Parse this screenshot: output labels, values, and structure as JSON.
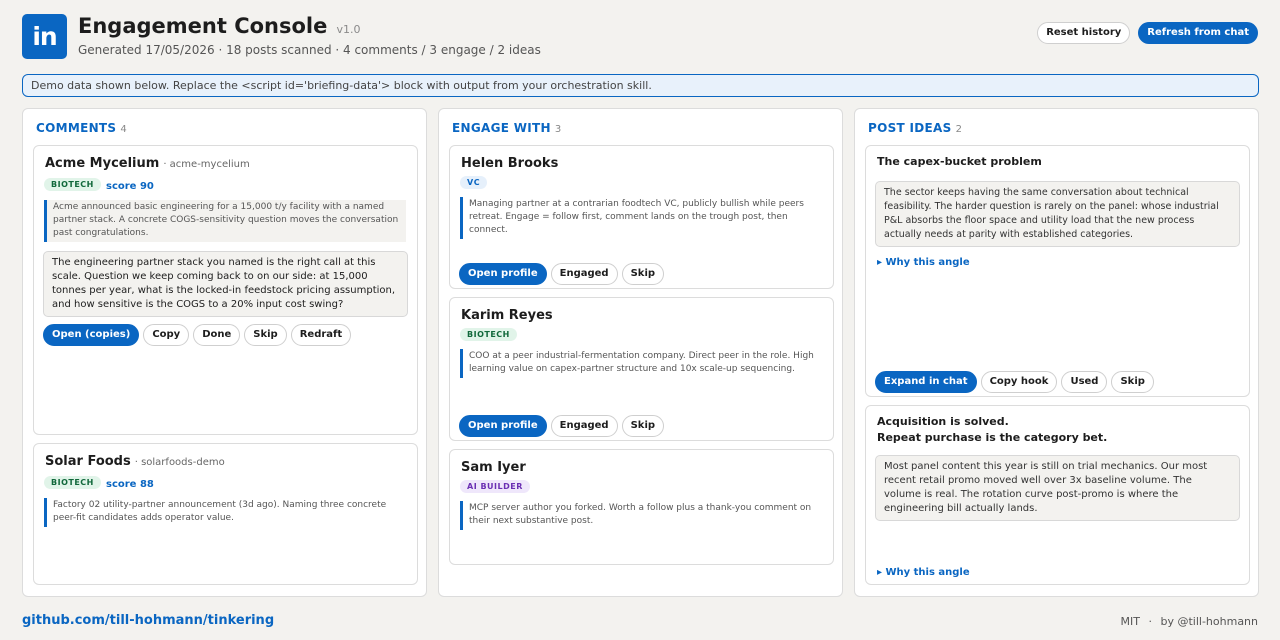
{
  "app": {
    "logo_text": "in",
    "title": "Engagement Console",
    "version": "v1.0",
    "subtitle": "Generated 17/05/2026 · 18 posts scanned · 4 comments / 3 engage / 2 ideas",
    "brand_color": "#0a66c2"
  },
  "header_actions": {
    "reset_label": "Reset history",
    "refresh_label": "Refresh from chat"
  },
  "banner": {
    "text": "Demo data shown below. Replace the <script id='briefing-data'> block with output from your orchestration skill."
  },
  "comments": {
    "heading": "COMMENTS",
    "count": "4",
    "cards": [
      {
        "name": "Acme Mycelium",
        "handle": "· acme-mycelium",
        "tag": "BIOTECH",
        "score": "score 90",
        "context": "Acme announced basic engineering for a 15,000 t/y facility with a named partner stack. A concrete COGS-sensitivity question moves the conversation past congratulations.",
        "draft": "The engineering partner stack you named is the right call at this scale. Question we keep coming back to on our side: at 15,000 tonnes per year, what is the locked-in feedstock pricing assumption, and how sensitive is the COGS to a 20% input cost swing?",
        "actions": [
          "Open (copies)",
          "Copy",
          "Done",
          "Skip",
          "Redraft"
        ]
      },
      {
        "name": "Solar Foods",
        "handle": "· solarfoods-demo",
        "tag": "BIOTECH",
        "score": "score 88",
        "context": "Factory 02 utility-partner announcement (3d ago). Naming three concrete peer-fit candidates adds operator value."
      }
    ]
  },
  "engage": {
    "heading": "ENGAGE WITH",
    "count": "3",
    "cards": [
      {
        "name": "Helen Brooks",
        "tag": "VC",
        "context": "Managing partner at a contrarian foodtech VC, publicly bullish while peers retreat. Engage = follow first, comment lands on the trough post, then connect.",
        "actions": [
          "Open profile",
          "Engaged",
          "Skip"
        ]
      },
      {
        "name": "Karim Reyes",
        "tag": "BIOTECH",
        "context": "COO at a peer industrial-fermentation company. Direct peer in the role. High learning value on capex-partner structure and 10x scale-up sequencing.",
        "actions": [
          "Open profile",
          "Engaged",
          "Skip"
        ]
      },
      {
        "name": "Sam Iyer",
        "tag": "AI BUILDER",
        "context": "MCP server author you forked. Worth a follow plus a thank-you comment on their next substantive post."
      }
    ]
  },
  "ideas": {
    "heading": "POST IDEAS",
    "count": "2",
    "cards": [
      {
        "title": "The capex-bucket problem",
        "body": "The sector keeps having the same conversation about technical feasibility. The harder question is rarely on the panel: whose industrial P&L absorbs the floor space and utility load that the new process actually needs at parity with established categories.",
        "why": "▸ Why this angle",
        "actions": [
          "Expand in chat",
          "Copy hook",
          "Used",
          "Skip"
        ]
      },
      {
        "title_line1": "Acquisition is solved.",
        "title_line2": "Repeat purchase is the category bet.",
        "body": "Most panel content this year is still on trial mechanics. Our most recent retail promo moved well over 3x baseline volume. The volume is real. The rotation curve post-promo is where the engineering bill actually lands.",
        "why": "▸ Why this angle"
      }
    ]
  },
  "footer": {
    "link": "github.com/till-hohmann/tinkering",
    "license": "MIT",
    "separator": "·",
    "author": "by @till-hohmann"
  }
}
